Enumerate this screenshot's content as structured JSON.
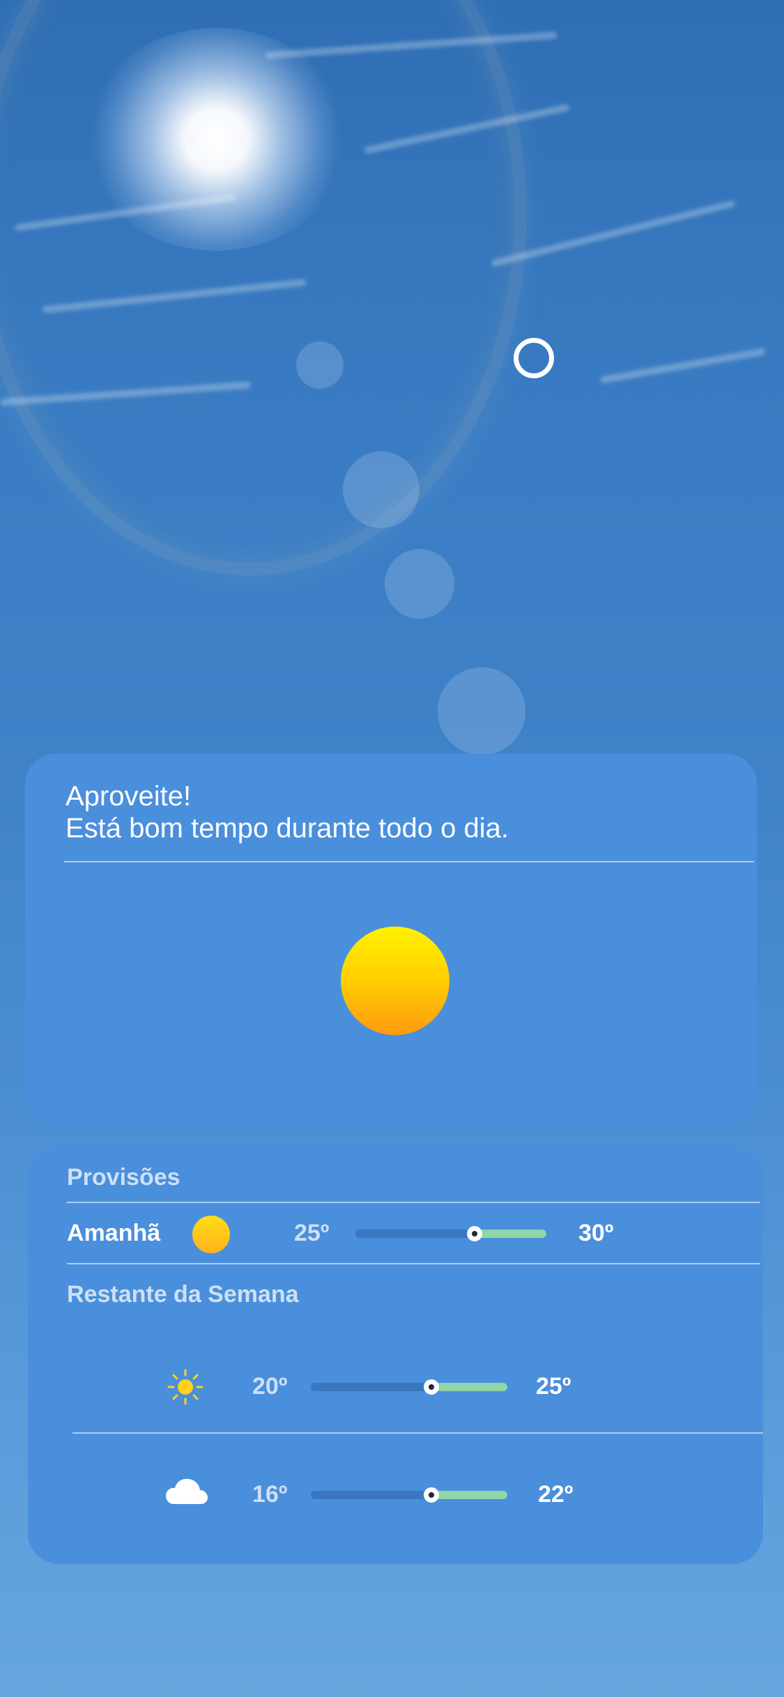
{
  "hero": {
    "title": "Aproveite!",
    "subtitle": "Está bom tempo durante todo o dia."
  },
  "forecast": {
    "section_title": "Provisões",
    "tomorrow": {
      "label": "Amanhã",
      "icon": "sun-icon",
      "low": "25º",
      "high": "30º",
      "current_fraction": 0.6
    },
    "rest_title": "Restante da Semana",
    "days": [
      {
        "icon": "sun-outline-icon",
        "low": "20º",
        "high": "25º",
        "current_fraction": 0.6
      },
      {
        "icon": "cloud-icon",
        "low": "16º",
        "high": "22º",
        "current_fraction": 0.6
      }
    ]
  },
  "colors": {
    "card": "#4a8fdc",
    "range_fill": "#8fd6a8",
    "sun_top": "#fff200",
    "sun_bottom": "#ff9a10"
  }
}
